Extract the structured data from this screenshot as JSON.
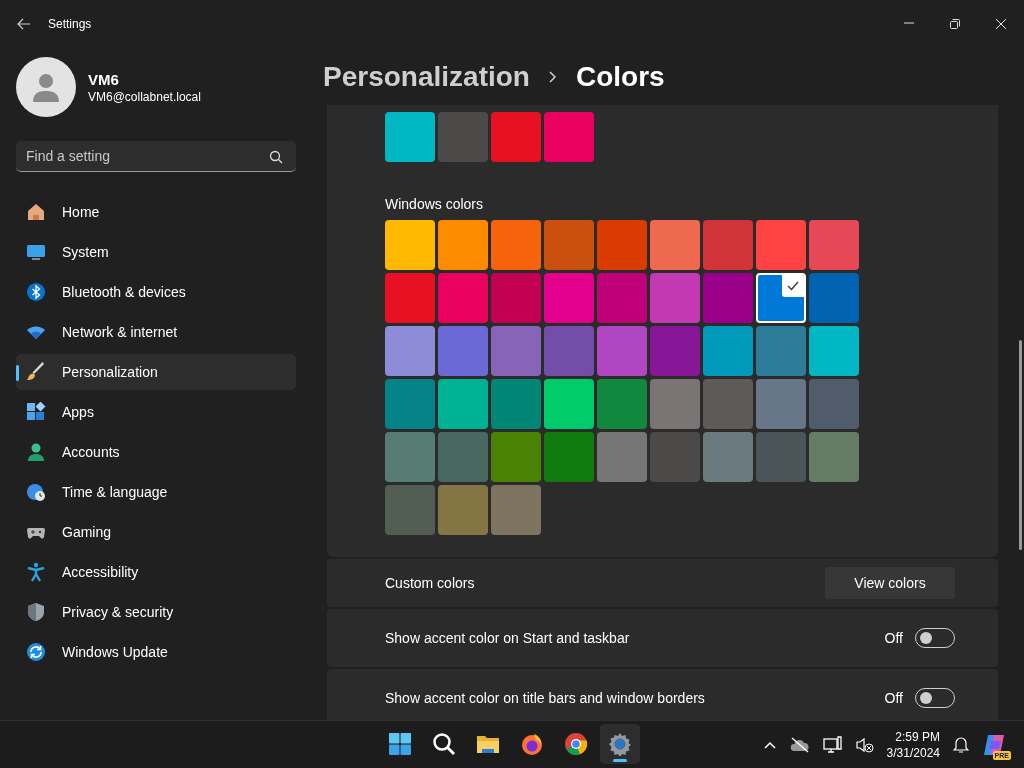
{
  "window": {
    "title": "Settings"
  },
  "account": {
    "name": "VM6",
    "email": "VM6@collabnet.local"
  },
  "search": {
    "placeholder": "Find a setting"
  },
  "nav": [
    {
      "kind": "home",
      "label": "Home",
      "selected": false
    },
    {
      "kind": "system",
      "label": "System",
      "selected": false
    },
    {
      "kind": "bluetooth",
      "label": "Bluetooth & devices",
      "selected": false
    },
    {
      "kind": "network",
      "label": "Network & internet",
      "selected": false
    },
    {
      "kind": "brush",
      "label": "Personalization",
      "selected": true
    },
    {
      "kind": "apps",
      "label": "Apps",
      "selected": false
    },
    {
      "kind": "accounts",
      "label": "Accounts",
      "selected": false
    },
    {
      "kind": "time",
      "label": "Time & language",
      "selected": false
    },
    {
      "kind": "gaming",
      "label": "Gaming",
      "selected": false
    },
    {
      "kind": "accessibility",
      "label": "Accessibility",
      "selected": false
    },
    {
      "kind": "privacy",
      "label": "Privacy & security",
      "selected": false
    },
    {
      "kind": "update",
      "label": "Windows Update",
      "selected": false
    }
  ],
  "breadcrumb": [
    "Personalization",
    "Colors"
  ],
  "recent_colors": [
    {
      "color": "#00b7c3",
      "selected": false
    },
    {
      "color": "#4c4a48",
      "selected": false
    },
    {
      "color": "#e81123",
      "selected": false
    },
    {
      "color": "#ea005e",
      "selected": false
    }
  ],
  "windows_colors": {
    "label": "Windows colors",
    "swatches": [
      {
        "color": "#ffb900",
        "selected": false
      },
      {
        "color": "#ff8c00",
        "selected": false
      },
      {
        "color": "#f7630c",
        "selected": false
      },
      {
        "color": "#ca5010",
        "selected": false
      },
      {
        "color": "#da3b01",
        "selected": false
      },
      {
        "color": "#ef6950",
        "selected": false
      },
      {
        "color": "#d13438",
        "selected": false
      },
      {
        "color": "#ff4343",
        "selected": false
      },
      {
        "color": "#e74856",
        "selected": false
      },
      {
        "color": "#e81123",
        "selected": false
      },
      {
        "color": "#ea005e",
        "selected": false
      },
      {
        "color": "#c30052",
        "selected": false
      },
      {
        "color": "#e3008c",
        "selected": false
      },
      {
        "color": "#bf0077",
        "selected": false
      },
      {
        "color": "#c239b3",
        "selected": false
      },
      {
        "color": "#9a0089",
        "selected": false
      },
      {
        "color": "#0078d7",
        "selected": true
      },
      {
        "color": "#0063b1",
        "selected": false
      },
      {
        "color": "#8e8cd8",
        "selected": false
      },
      {
        "color": "#6b69d6",
        "selected": false
      },
      {
        "color": "#8764b8",
        "selected": false
      },
      {
        "color": "#744da9",
        "selected": false
      },
      {
        "color": "#b146c2",
        "selected": false
      },
      {
        "color": "#881798",
        "selected": false
      },
      {
        "color": "#0099bc",
        "selected": false
      },
      {
        "color": "#2d7d9a",
        "selected": false
      },
      {
        "color": "#00b7c3",
        "selected": false
      },
      {
        "color": "#038387",
        "selected": false
      },
      {
        "color": "#00b294",
        "selected": false
      },
      {
        "color": "#018574",
        "selected": false
      },
      {
        "color": "#00cc6a",
        "selected": false
      },
      {
        "color": "#10893e",
        "selected": false
      },
      {
        "color": "#7a7574",
        "selected": false
      },
      {
        "color": "#5d5a58",
        "selected": false
      },
      {
        "color": "#68768a",
        "selected": false
      },
      {
        "color": "#515c6b",
        "selected": false
      },
      {
        "color": "#567c73",
        "selected": false
      },
      {
        "color": "#486860",
        "selected": false
      },
      {
        "color": "#498205",
        "selected": false
      },
      {
        "color": "#107c10",
        "selected": false
      },
      {
        "color": "#767676",
        "selected": false
      },
      {
        "color": "#4c4a48",
        "selected": false
      },
      {
        "color": "#69797e",
        "selected": false
      },
      {
        "color": "#4a5459",
        "selected": false
      },
      {
        "color": "#647c64",
        "selected": false
      },
      {
        "color": "#525e54",
        "selected": false
      },
      {
        "color": "#847545",
        "selected": false
      },
      {
        "color": "#7e735f",
        "selected": false
      }
    ]
  },
  "settings_rows": [
    {
      "kind": "button",
      "label": "Custom colors",
      "button": "View colors"
    },
    {
      "kind": "toggle",
      "label": "Show accent color on Start and taskbar",
      "state_label": "Off",
      "on": false
    },
    {
      "kind": "toggle",
      "label": "Show accent color on title bars and window borders",
      "state_label": "Off",
      "on": false
    }
  ],
  "taskbar": {
    "apps": [
      {
        "kind": "start",
        "selected": false
      },
      {
        "kind": "search",
        "selected": false
      },
      {
        "kind": "folder",
        "selected": false
      },
      {
        "kind": "firefox",
        "selected": false
      },
      {
        "kind": "chrome",
        "selected": false
      },
      {
        "kind": "settings",
        "selected": true
      }
    ],
    "time": "2:59 PM",
    "date": "3/31/2024",
    "copilot_badge": "PRE"
  }
}
